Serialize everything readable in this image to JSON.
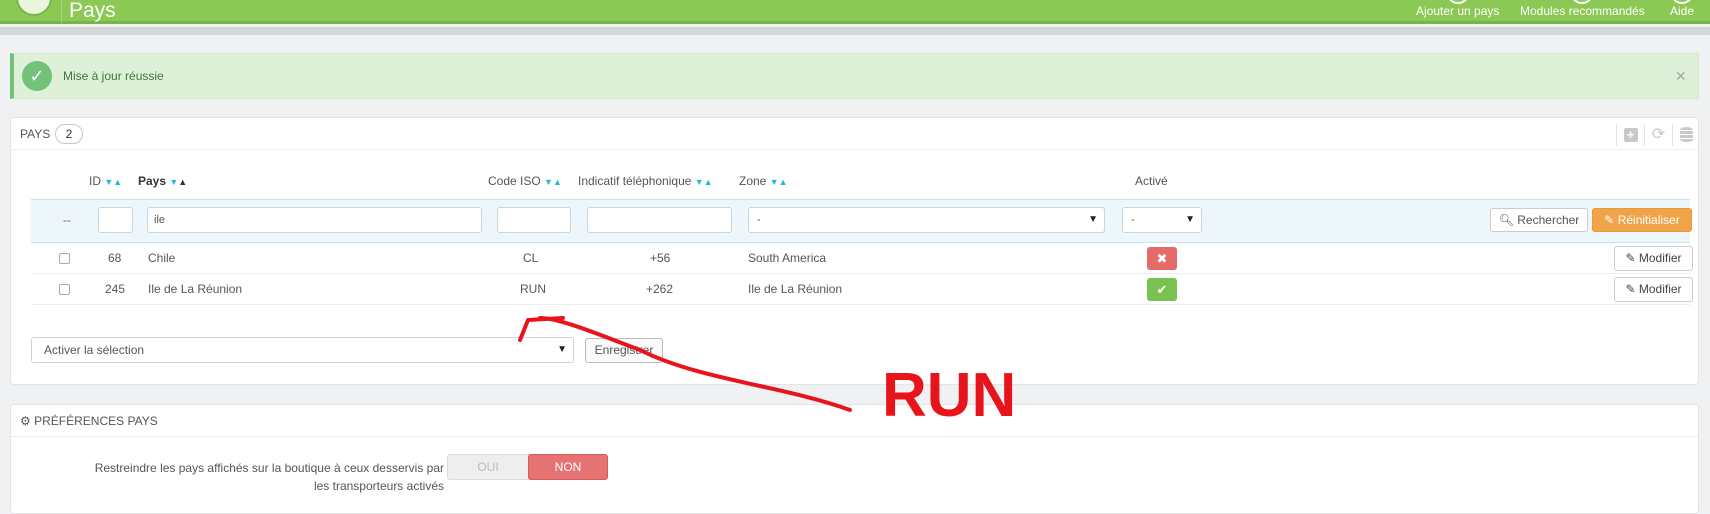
{
  "header": {
    "title": "Pays",
    "actions": [
      "Ajouter un pays",
      "Modules recommandés",
      "Aide"
    ]
  },
  "alert": {
    "message": "Mise à jour réussie",
    "close": "×"
  },
  "countries_panel": {
    "title": "PAYS",
    "count": "2",
    "columns": {
      "id": "ID",
      "country": "Pays",
      "iso": "Code ISO",
      "phone": "Indicatif téléphonique",
      "zone": "Zone",
      "active": "Activé"
    },
    "filters": {
      "dash": "--",
      "id": "",
      "country": "ile",
      "iso": "",
      "phone": "",
      "zone": "-",
      "active": "-",
      "search_label": "Rechercher",
      "reset_label": "Réinitialiser"
    },
    "rows": [
      {
        "id": "68",
        "country": "Chile",
        "iso": "CL",
        "phone": "+56",
        "zone": "South America",
        "active": false,
        "edit_label": "Modifier"
      },
      {
        "id": "245",
        "country": "Ile de La Réunion",
        "iso": "RUN",
        "phone": "+262",
        "zone": "Ile de La Réunion",
        "active": true,
        "edit_label": "Modifier"
      }
    ],
    "bulk": {
      "selected": "Activer la sélection",
      "save_label": "Enregistrer"
    }
  },
  "prefs_panel": {
    "title": "PRÉFÉRENCES PAYS",
    "setting_line1": "Restreindre les pays affichés sur la boutique à ceux desservis par",
    "setting_line2": "les transporteurs activés",
    "yes_label": "OUI",
    "no_label": "NON"
  },
  "annotation": {
    "text": "RUN",
    "color": "#e8141b"
  },
  "colors": {
    "header": "#8bc954",
    "success": "#72c279",
    "reset": "#f0a347",
    "disabled": "#e56a6a",
    "enabled": "#79c151"
  }
}
